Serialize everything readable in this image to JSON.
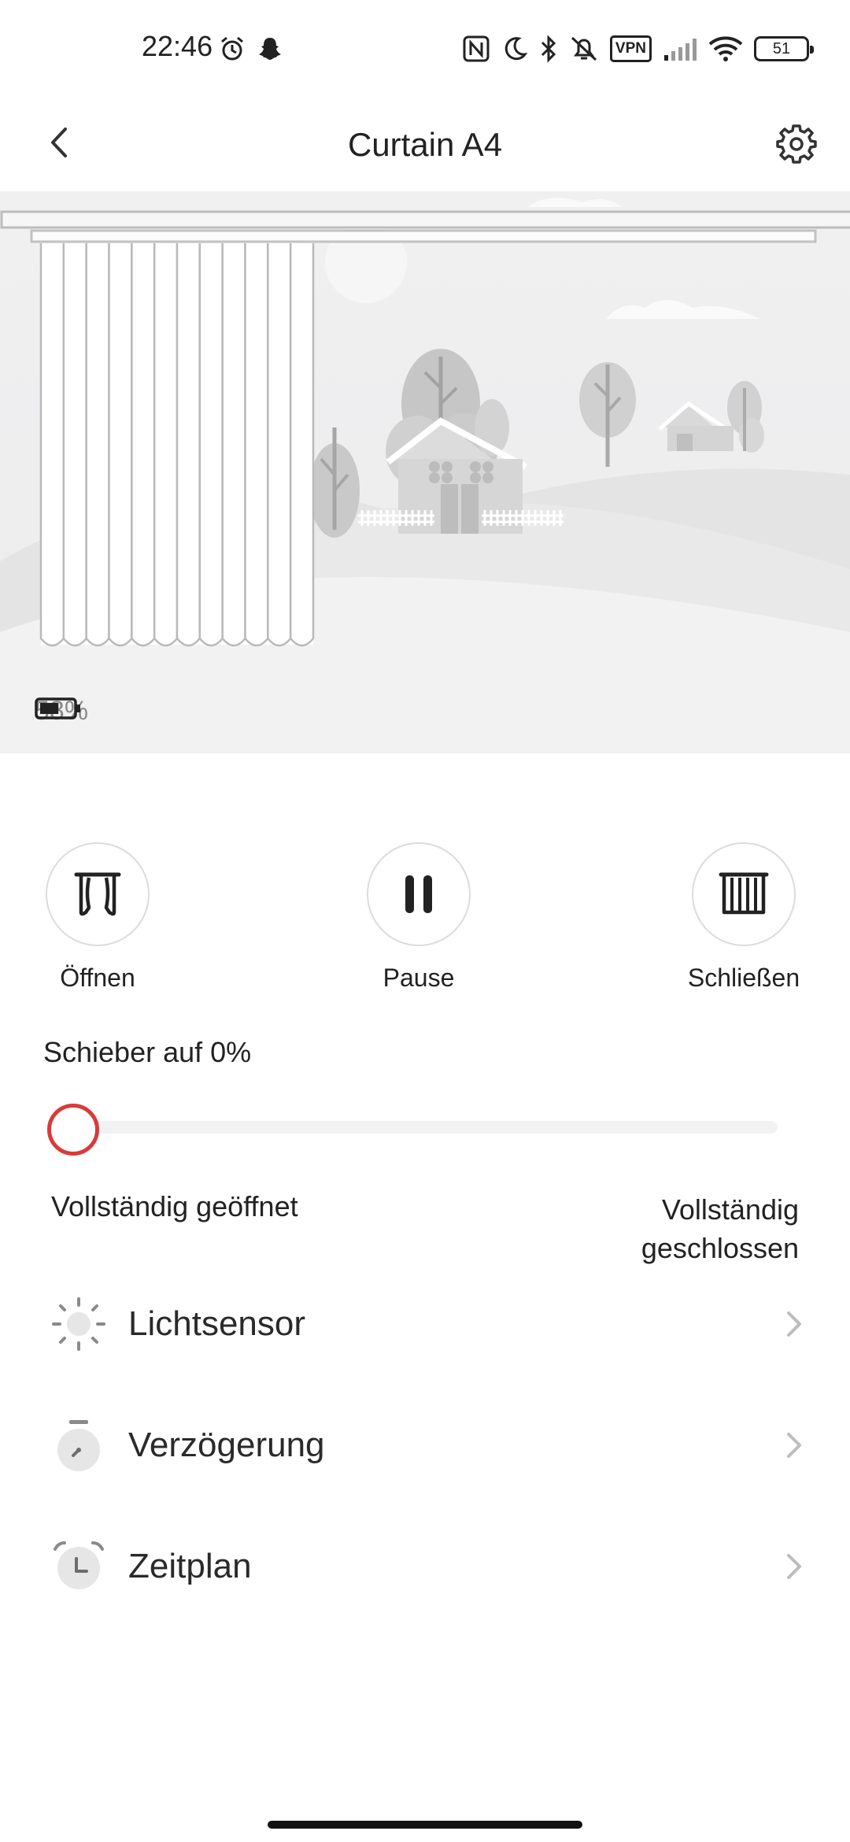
{
  "status_bar": {
    "time": "22:46",
    "vpn_label": "VPN",
    "battery_level": "51",
    "icons": [
      "alarm-icon",
      "snapchat-icon",
      "nfc-icon",
      "moon-icon",
      "bluetooth-icon",
      "mute-icon",
      "vpn-icon",
      "signal-icon",
      "wifi-icon",
      "battery-icon"
    ]
  },
  "header": {
    "title": "Curtain A4",
    "back_icon": "chevron-left-icon",
    "settings_icon": "gear-icon"
  },
  "device": {
    "battery_percent": "58%",
    "battery_level": 0.58
  },
  "controls": {
    "open_label": "Öffnen",
    "pause_label": "Pause",
    "close_label": "Schließen"
  },
  "slider": {
    "title": "Schieber auf 0%",
    "value": 0,
    "min_label": "Vollständig geöffnet",
    "max_label": "Vollständig geschlossen"
  },
  "menu": {
    "items": [
      {
        "label": "Lichtsensor",
        "icon": "sun-icon"
      },
      {
        "label": "Verzögerung",
        "icon": "timer-icon"
      },
      {
        "label": "Zeitplan",
        "icon": "alarm-clock-icon"
      }
    ]
  },
  "colors": {
    "accent": "#d83b3b",
    "scene_bg": "#efeff0",
    "text": "#222222"
  }
}
